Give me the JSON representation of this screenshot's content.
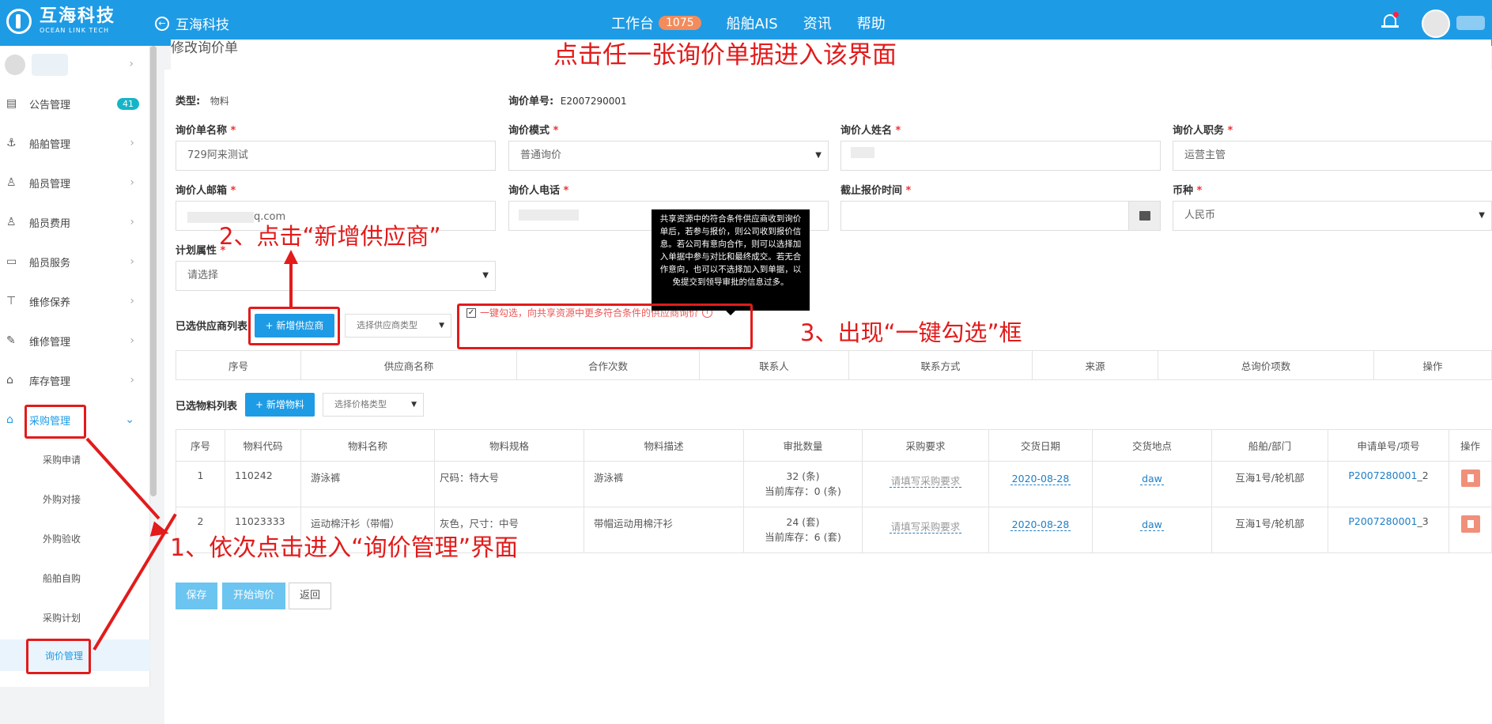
{
  "topbar": {
    "logo_cn": "互海科技",
    "logo_en": "OCEAN LINK TECH",
    "back_label": "互海科技",
    "nav": [
      {
        "label": "工作台",
        "badge": "1075"
      },
      {
        "label": "船舶AIS"
      },
      {
        "label": "资讯"
      },
      {
        "label": "帮助"
      }
    ]
  },
  "sidebar": {
    "items": [
      {
        "label": "公告管理",
        "badge": "41",
        "icon": "book-icon"
      },
      {
        "label": "船舶管理",
        "icon": "anchor-icon"
      },
      {
        "label": "船员管理",
        "icon": "user-icon"
      },
      {
        "label": "船员费用",
        "icon": "user-icon"
      },
      {
        "label": "船员服务",
        "icon": "monitor-icon"
      },
      {
        "label": "维修保养",
        "icon": "hammer-icon"
      },
      {
        "label": "维修管理",
        "icon": "wrench-icon"
      },
      {
        "label": "库存管理",
        "icon": "inbox-icon"
      },
      {
        "label": "采购管理",
        "icon": "bag-icon"
      }
    ],
    "subitems": [
      "采购申请",
      "外购对接",
      "外购验收",
      "船舶自购",
      "采购计划",
      "询价管理"
    ]
  },
  "page": {
    "title": "修改询价单",
    "type_label": "类型:",
    "type_value": "物料",
    "no_label": "询价单号:",
    "no_value": "E2007290001",
    "fields": {
      "name_label": "询价单名称",
      "name_value": "729阿来测试",
      "mode_label": "询价模式",
      "mode_value": "普通询价",
      "person_label": "询价人姓名",
      "duty_label": "询价人职务",
      "duty_value": "运营主管",
      "email_label": "询价人邮箱",
      "email_value": "q.com",
      "phone_label": "询价人电话",
      "deadline_label": "截止报价时间",
      "currency_label": "币种",
      "currency_value": "人民币",
      "plan_label": "计划属性",
      "plan_placeholder": "请选择"
    },
    "supplier_section": {
      "label": "已选供应商列表",
      "add_button": "新增供应商",
      "type_select": "选择供应商类型",
      "checkbox_text": "一键勾选，向共享资源中更多符合条件的供应商询价",
      "tooltip": "共享资源中的符合条件供应商收到询价单后，若参与报价，则公司收到报价信息。若公司有意向合作，则可以选择加入单据中参与对比和最终成交。若无合作意向，也可以不选择加入到单据，以免提交到领导审批的信息过多。",
      "columns": [
        "序号",
        "供应商名称",
        "合作次数",
        "联系人",
        "联系方式",
        "来源",
        "总询价项数",
        "操作"
      ]
    },
    "material_section": {
      "label": "已选物料列表",
      "add_button": "新增物料",
      "type_select": "选择价格类型",
      "columns": [
        "序号",
        "物料代码",
        "物料名称",
        "物料规格",
        "物料描述",
        "审批数量",
        "采购要求",
        "交货日期",
        "交货地点",
        "船舶/部门",
        "申请单号/项号",
        "操作"
      ],
      "rows": [
        {
          "no": "1",
          "code": "110242",
          "name": "游泳裤",
          "spec": "尺码：特大号",
          "desc": "游泳裤",
          "qty": "32 (条)",
          "stock": "当前库存：0 (条)",
          "req": "请填写采购要求",
          "date": "2020-08-28",
          "place": "daw",
          "ship": "互海1号/轮机部",
          "apply": "P2007280001",
          "item": "_2"
        },
        {
          "no": "2",
          "code": "11023333",
          "name": "运动棉汗衫（带帽）",
          "spec": "灰色，尺寸：中号",
          "desc": "带帽运动用棉汗衫",
          "qty": "24 (套)",
          "stock": "当前库存：6 (套)",
          "req": "请填写采购要求",
          "date": "2020-08-28",
          "place": "daw",
          "ship": "互海1号/轮机部",
          "apply": "P2007280001",
          "item": "_3"
        }
      ]
    },
    "buttons": {
      "save": "保存",
      "start": "开始询价",
      "back": "返回"
    }
  },
  "annotations": {
    "top": "点击任一张询价单据进入该界面",
    "step1": "1、依次点击进入“询价管理”界面",
    "step2": "2、点击“新增供应商”",
    "step3": "3、出现“一键勾选”框"
  }
}
